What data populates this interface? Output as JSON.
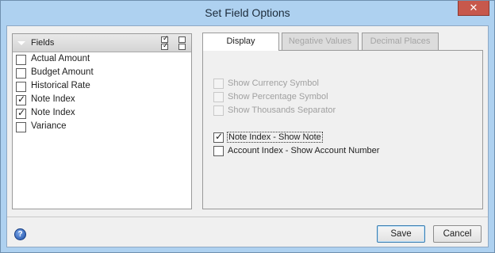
{
  "window": {
    "title": "Set Field Options",
    "close_glyph": "✕"
  },
  "fields_panel": {
    "header_label": "Fields",
    "items": [
      {
        "label": "Actual Amount",
        "checked": false
      },
      {
        "label": "Budget Amount",
        "checked": false
      },
      {
        "label": "Historical Rate",
        "checked": false
      },
      {
        "label": "Note Index",
        "checked": true
      },
      {
        "label": "Note Index",
        "checked": true
      },
      {
        "label": "Variance",
        "checked": false
      }
    ]
  },
  "tabs": [
    {
      "label": "Display",
      "active": true,
      "enabled": true
    },
    {
      "label": "Negative Values",
      "active": false,
      "enabled": false
    },
    {
      "label": "Decimal Places",
      "active": false,
      "enabled": false
    }
  ],
  "display_options": {
    "show_currency_symbol": "Show Currency Symbol",
    "show_percentage_symbol": "Show Percentage Symbol",
    "show_thousands_separator": "Show Thousands Separator",
    "note_index_show_note": "Note Index - Show Note",
    "account_index_show_account_number": "Account Index - Show Account Number"
  },
  "footer": {
    "help_glyph": "?",
    "save_label": "Save",
    "cancel_label": "Cancel"
  },
  "colors": {
    "window_frame": "#aed1f0",
    "client_background": "#f0f0f0",
    "close_button": "#c7584c",
    "disabled_text": "#a5a5a5"
  },
  "icons": {
    "close": "close-icon",
    "help": "help-icon",
    "header_collapse": "chevron-down-icon"
  }
}
